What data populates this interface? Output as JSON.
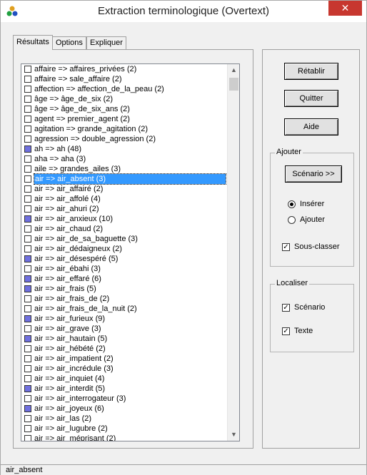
{
  "window": {
    "title": "Extraction terminologique (Overtext)",
    "close_label": "✕"
  },
  "tabs": [
    {
      "label": "Résultats",
      "active": true
    },
    {
      "label": "Options",
      "active": false
    },
    {
      "label": "Expliquer",
      "active": false
    }
  ],
  "list": {
    "selected_index": 11,
    "items": [
      {
        "text": "affaire => affaires_privées (2)",
        "filled": false
      },
      {
        "text": "affaire => sale_affaire (2)",
        "filled": false
      },
      {
        "text": "affection => affection_de_la_peau (2)",
        "filled": false
      },
      {
        "text": "âge => âge_de_six (2)",
        "filled": false
      },
      {
        "text": "âge => âge_de_six_ans (2)",
        "filled": false
      },
      {
        "text": "agent => premier_agent (2)",
        "filled": false
      },
      {
        "text": "agitation => grande_agitation (2)",
        "filled": false
      },
      {
        "text": "agression => double_agression (2)",
        "filled": false
      },
      {
        "text": "ah => ah (48)",
        "filled": true
      },
      {
        "text": "aha => aha (3)",
        "filled": false
      },
      {
        "text": "aile => grandes_ailes (3)",
        "filled": false
      },
      {
        "text": "air => air_absent (3)",
        "filled": false
      },
      {
        "text": "air => air_affairé (2)",
        "filled": false
      },
      {
        "text": "air => air_affolé (4)",
        "filled": false
      },
      {
        "text": "air => air_ahuri (2)",
        "filled": false
      },
      {
        "text": "air => air_anxieux (10)",
        "filled": true
      },
      {
        "text": "air => air_chaud (2)",
        "filled": false
      },
      {
        "text": "air => air_de_sa_baguette (3)",
        "filled": false
      },
      {
        "text": "air => air_dédaigneux (2)",
        "filled": false
      },
      {
        "text": "air => air_désespéré (5)",
        "filled": true
      },
      {
        "text": "air => air_ébahi (3)",
        "filled": false
      },
      {
        "text": "air => air_effaré (6)",
        "filled": true
      },
      {
        "text": "air => air_frais (5)",
        "filled": true
      },
      {
        "text": "air => air_frais_de (2)",
        "filled": false
      },
      {
        "text": "air => air_frais_de_la_nuit (2)",
        "filled": false
      },
      {
        "text": "air => air_furieux (9)",
        "filled": true
      },
      {
        "text": "air => air_grave (3)",
        "filled": false
      },
      {
        "text": "air => air_hautain (5)",
        "filled": true
      },
      {
        "text": "air => air_hébété (2)",
        "filled": false
      },
      {
        "text": "air => air_impatient (2)",
        "filled": false
      },
      {
        "text": "air => air_incrédule (3)",
        "filled": false
      },
      {
        "text": "air => air_inquiet (4)",
        "filled": false
      },
      {
        "text": "air => air_interdit (5)",
        "filled": true
      },
      {
        "text": "air => air_interrogateur (3)",
        "filled": false
      },
      {
        "text": "air => air_joyeux (6)",
        "filled": true
      },
      {
        "text": "air => air_las (2)",
        "filled": false
      },
      {
        "text": "air => air_lugubre (2)",
        "filled": false
      },
      {
        "text": "air => air_méprisant (2)",
        "filled": false
      }
    ]
  },
  "buttons": {
    "retablir": "Rétablir",
    "quitter": "Quitter",
    "aide": "Aide",
    "scenario": "Scénario >>"
  },
  "ajouter": {
    "legend": "Ajouter",
    "inserer": "Insérer",
    "ajouter_opt": "Ajouter",
    "sous_classer": "Sous-classer",
    "selected_radio": "inserer",
    "sous_classer_checked": true
  },
  "localiser": {
    "legend": "Localiser",
    "scenario": "Scénario",
    "texte": "Texte",
    "scenario_checked": true,
    "texte_checked": true
  },
  "status": {
    "text": "air_absent"
  },
  "colors": {
    "selection": "#3399ff",
    "filled_box": "#7070e0",
    "close": "#c7372f"
  }
}
